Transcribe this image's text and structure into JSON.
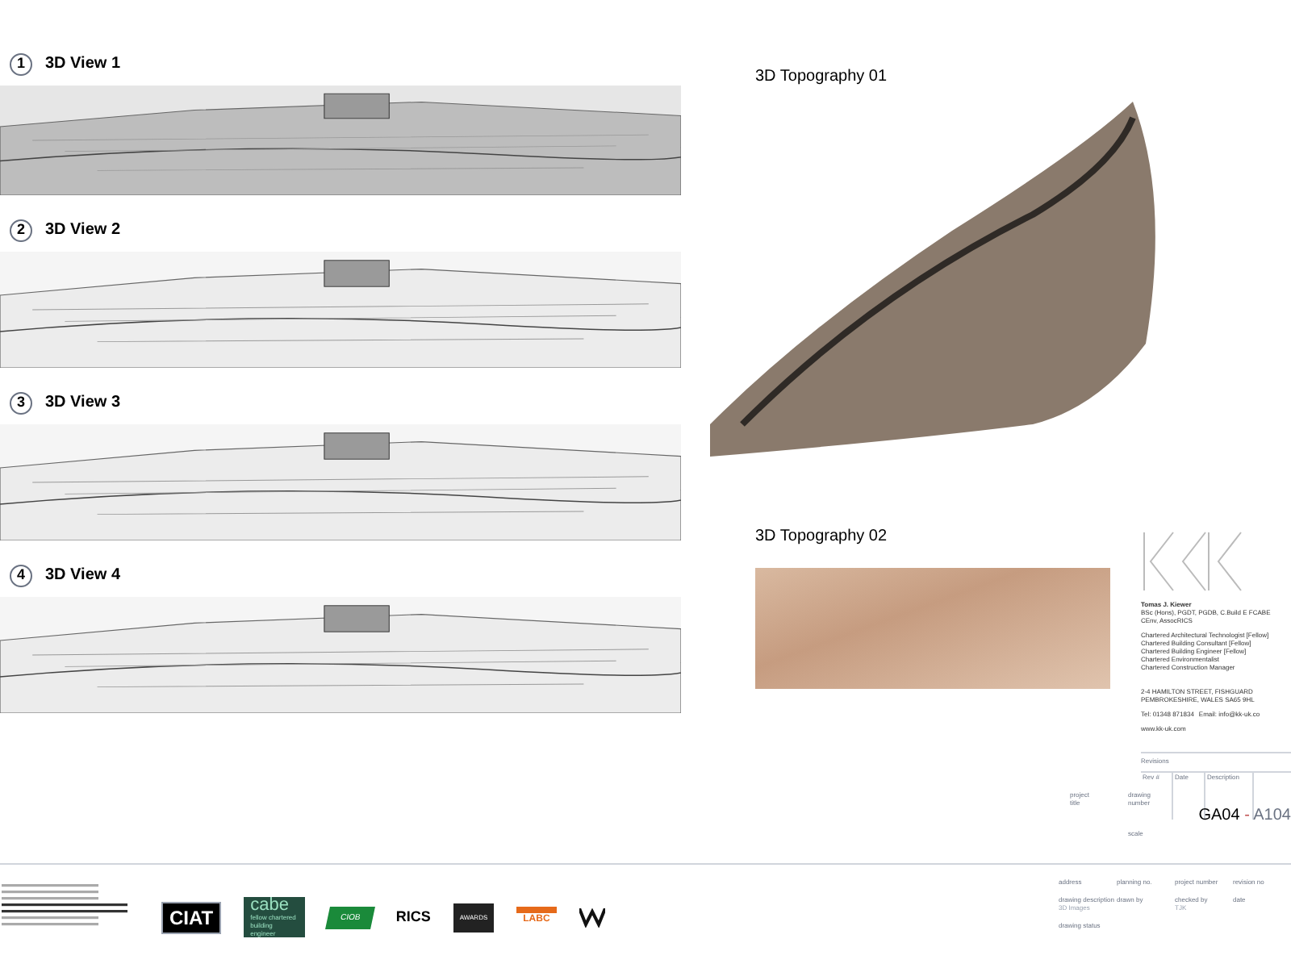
{
  "views": [
    {
      "number": "1",
      "title": "3D View 1",
      "kind": "dense"
    },
    {
      "number": "2",
      "title": "3D View 2",
      "kind": "light"
    },
    {
      "number": "3",
      "title": "3D View 3",
      "kind": "light"
    },
    {
      "number": "4",
      "title": "3D View 4",
      "kind": "light"
    }
  ],
  "topographies": [
    {
      "title": "3D Topography 01",
      "kind": "ridge"
    },
    {
      "title": "3D Topography 02",
      "kind": "flat"
    }
  ],
  "practice": {
    "name": "Tomas J. Kiewer",
    "qualifications": [
      "BSc (Hons), PGDT, PGDB, C.Build E FCABE",
      "CEnv, AssocRICS"
    ],
    "roles": [
      "Chartered Architectural Technologist [Fellow]",
      "Chartered Building Consultant [Fellow]",
      "Chartered Building Engineer [Fellow]",
      "Chartered Environmentalist",
      "Chartered Construction Manager"
    ],
    "address": [
      "2-4 HAMILTON STREET, FISHGUARD",
      "PEMBROKESHIRE, WALES SA65 9HL"
    ],
    "tel": "Tel: 01348 871834",
    "email": "Email: info@kk-uk.co",
    "web": "www.kk-uk.com"
  },
  "revisions": {
    "title": "Revisions",
    "columns": [
      "Rev #",
      "Date",
      "Description"
    ]
  },
  "project": {
    "title_label": "project title",
    "number_label": "drawing number",
    "scale_label": "scale",
    "code": "GA04",
    "separator": "-",
    "sheet": "A104"
  },
  "info_fields": [
    {
      "label": "address"
    },
    {
      "label": "planning no."
    },
    {
      "label": "project number"
    },
    {
      "label": "revision no"
    },
    {
      "label": "drawing description",
      "value": "3D Images"
    },
    {
      "label": "drawn by"
    },
    {
      "label": "checked by",
      "value": "TJK"
    },
    {
      "label": "date"
    },
    {
      "label": "drawing status"
    }
  ],
  "logos": [
    {
      "kind": "ciat",
      "text": "CIAT"
    },
    {
      "kind": "cabe",
      "text": "cabe",
      "sub": "fellow chartered building engineer"
    },
    {
      "kind": "green",
      "text": "CIOB"
    },
    {
      "kind": "rics",
      "text": "RICS"
    },
    {
      "kind": "dark",
      "text": "AWARDS"
    },
    {
      "kind": "labc",
      "text": "LABC"
    },
    {
      "kind": "mark"
    }
  ]
}
